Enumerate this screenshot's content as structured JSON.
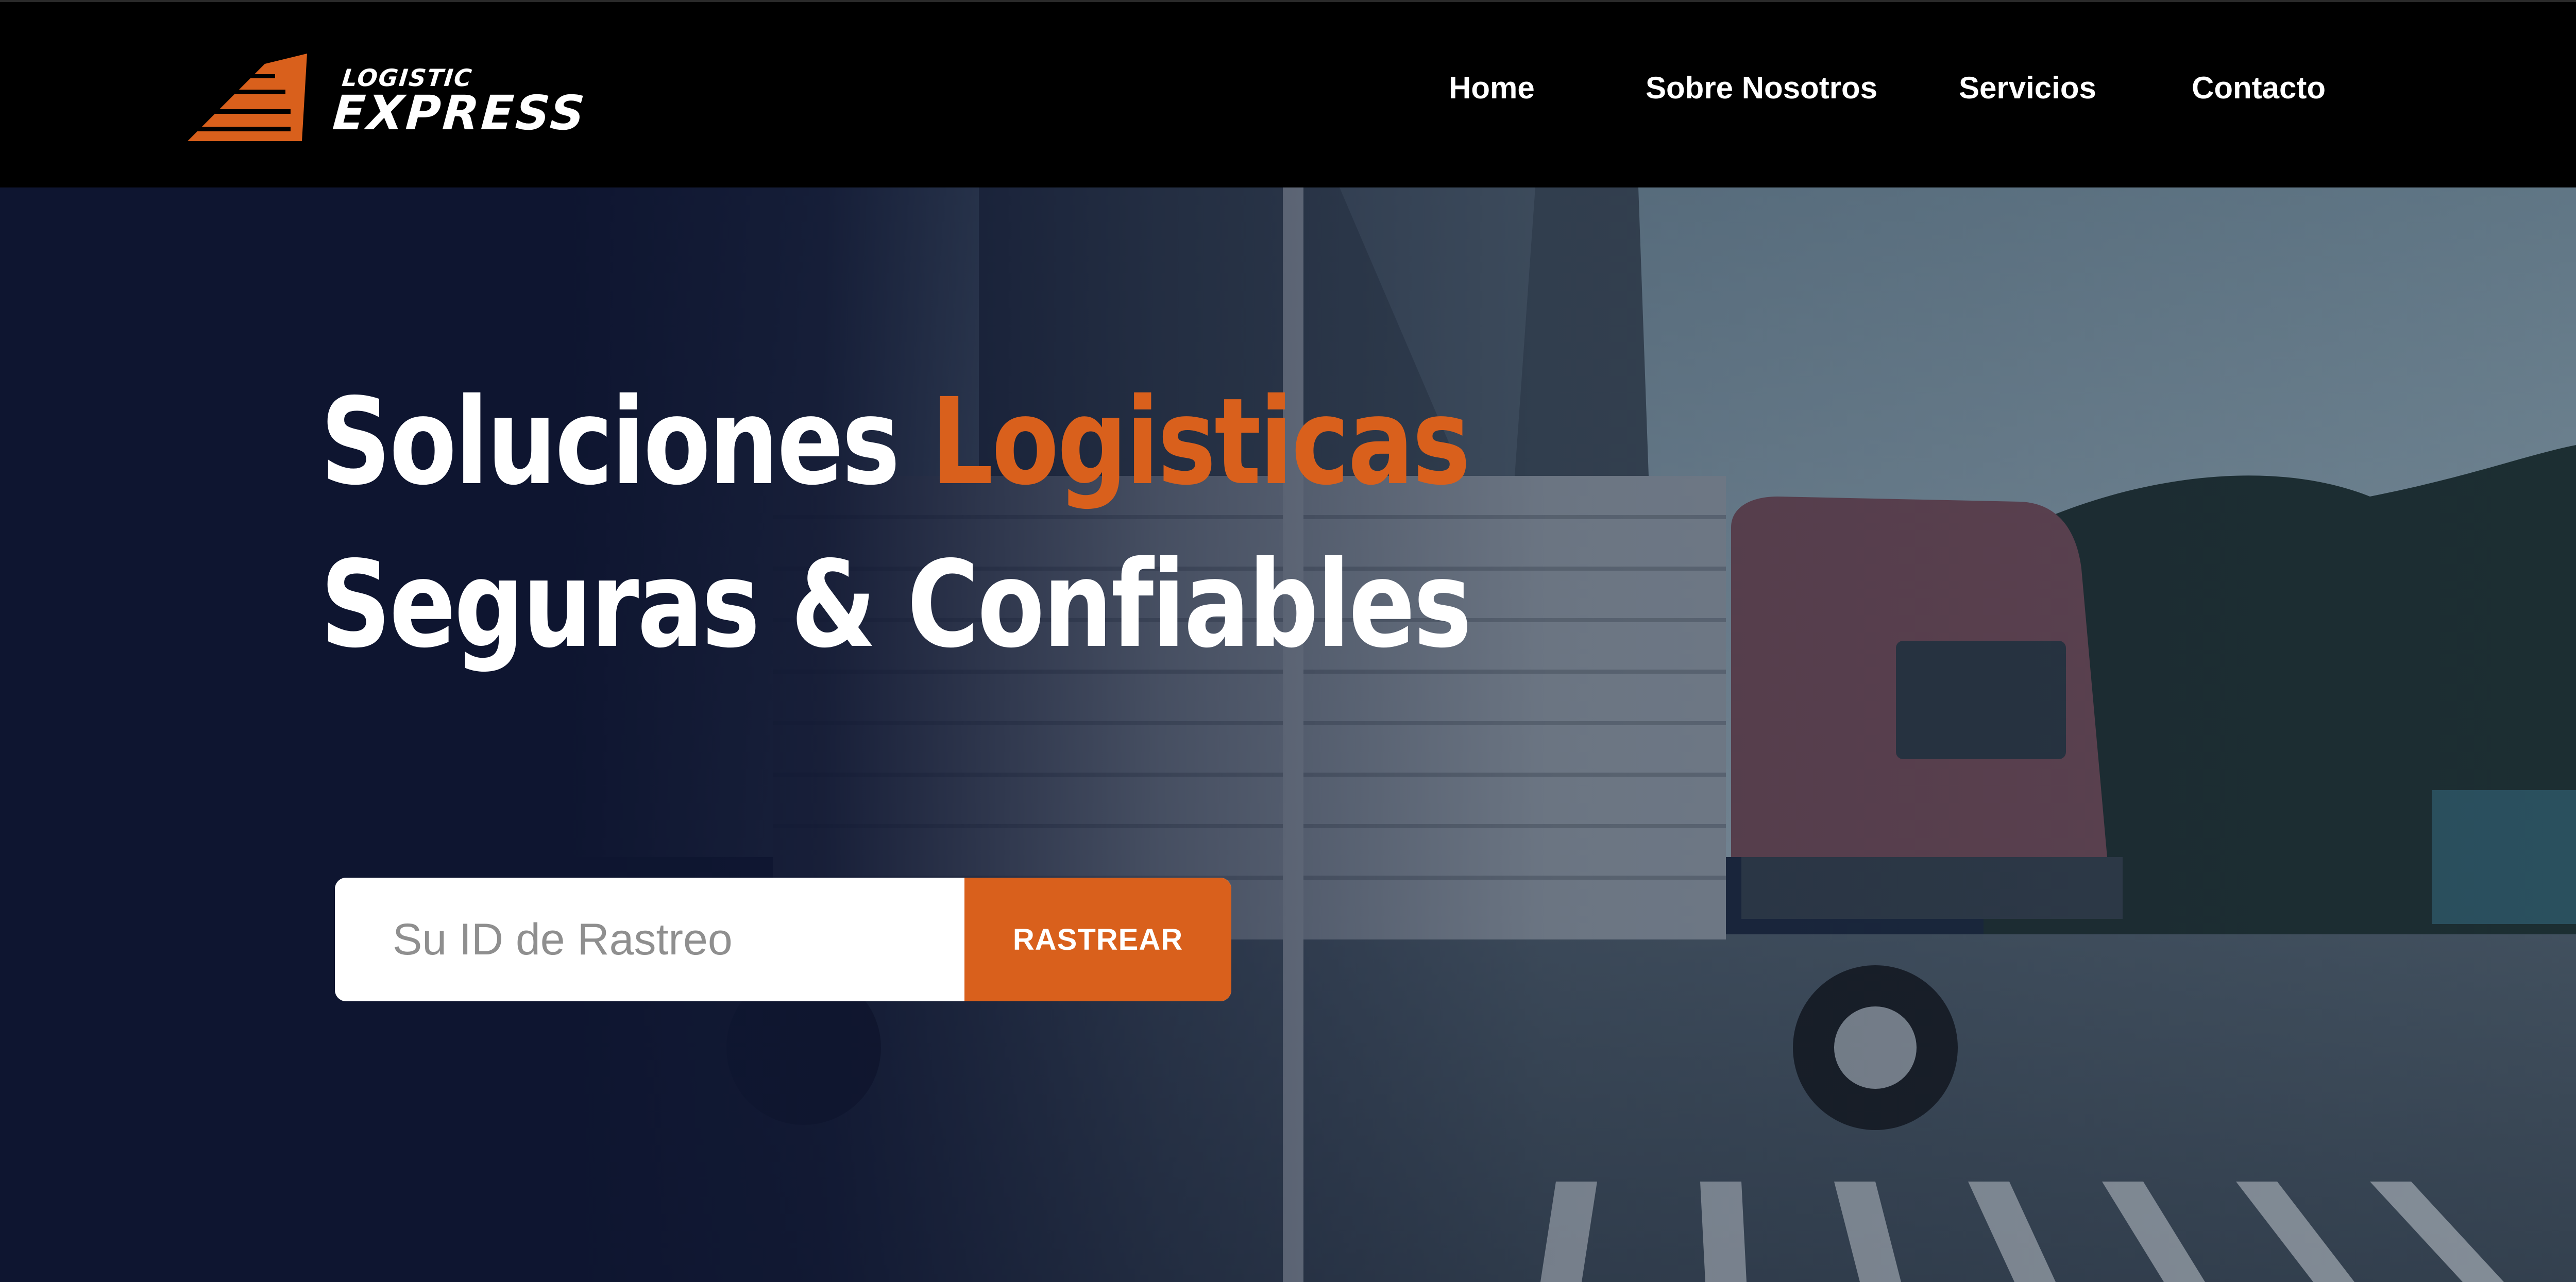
{
  "brand": {
    "top_text": "LOGISTIC",
    "main_text": "EXPRESS",
    "accent_color": "#d9601c"
  },
  "nav": {
    "items": [
      {
        "label": "Home"
      },
      {
        "label": "Sobre Nosotros"
      },
      {
        "label": "Servicios"
      },
      {
        "label": "Contacto"
      }
    ]
  },
  "hero": {
    "title_line1_part1": "Soluciones ",
    "title_line1_accent": "Logisticas",
    "title_line2": "Seguras & Confiables",
    "background": "truck-photo",
    "overlay_color": "#0e1530"
  },
  "tracking": {
    "placeholder": "Su ID de Rastreo",
    "value": "",
    "button_label": "RASTREAR"
  }
}
